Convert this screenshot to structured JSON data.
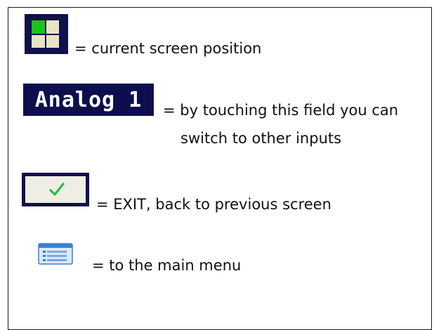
{
  "legend": {
    "position_text": "= current screen position",
    "input_field_label": "Analog 1",
    "input_text_line1": "= by touching this field you can",
    "input_text_line2": "switch to other inputs",
    "exit_text": "= EXIT, back to previous screen",
    "menu_text": "= to the main menu"
  },
  "icons": {
    "grid": "screen-position-grid-icon",
    "check": "check-icon",
    "menu": "main-menu-icon"
  },
  "colors": {
    "dark_navy": "#10104a",
    "grid_active": "#19c41c",
    "grid_cell": "#e8e4c2",
    "check_green": "#2fb84a",
    "menu_blue": "#3b7fd4"
  }
}
